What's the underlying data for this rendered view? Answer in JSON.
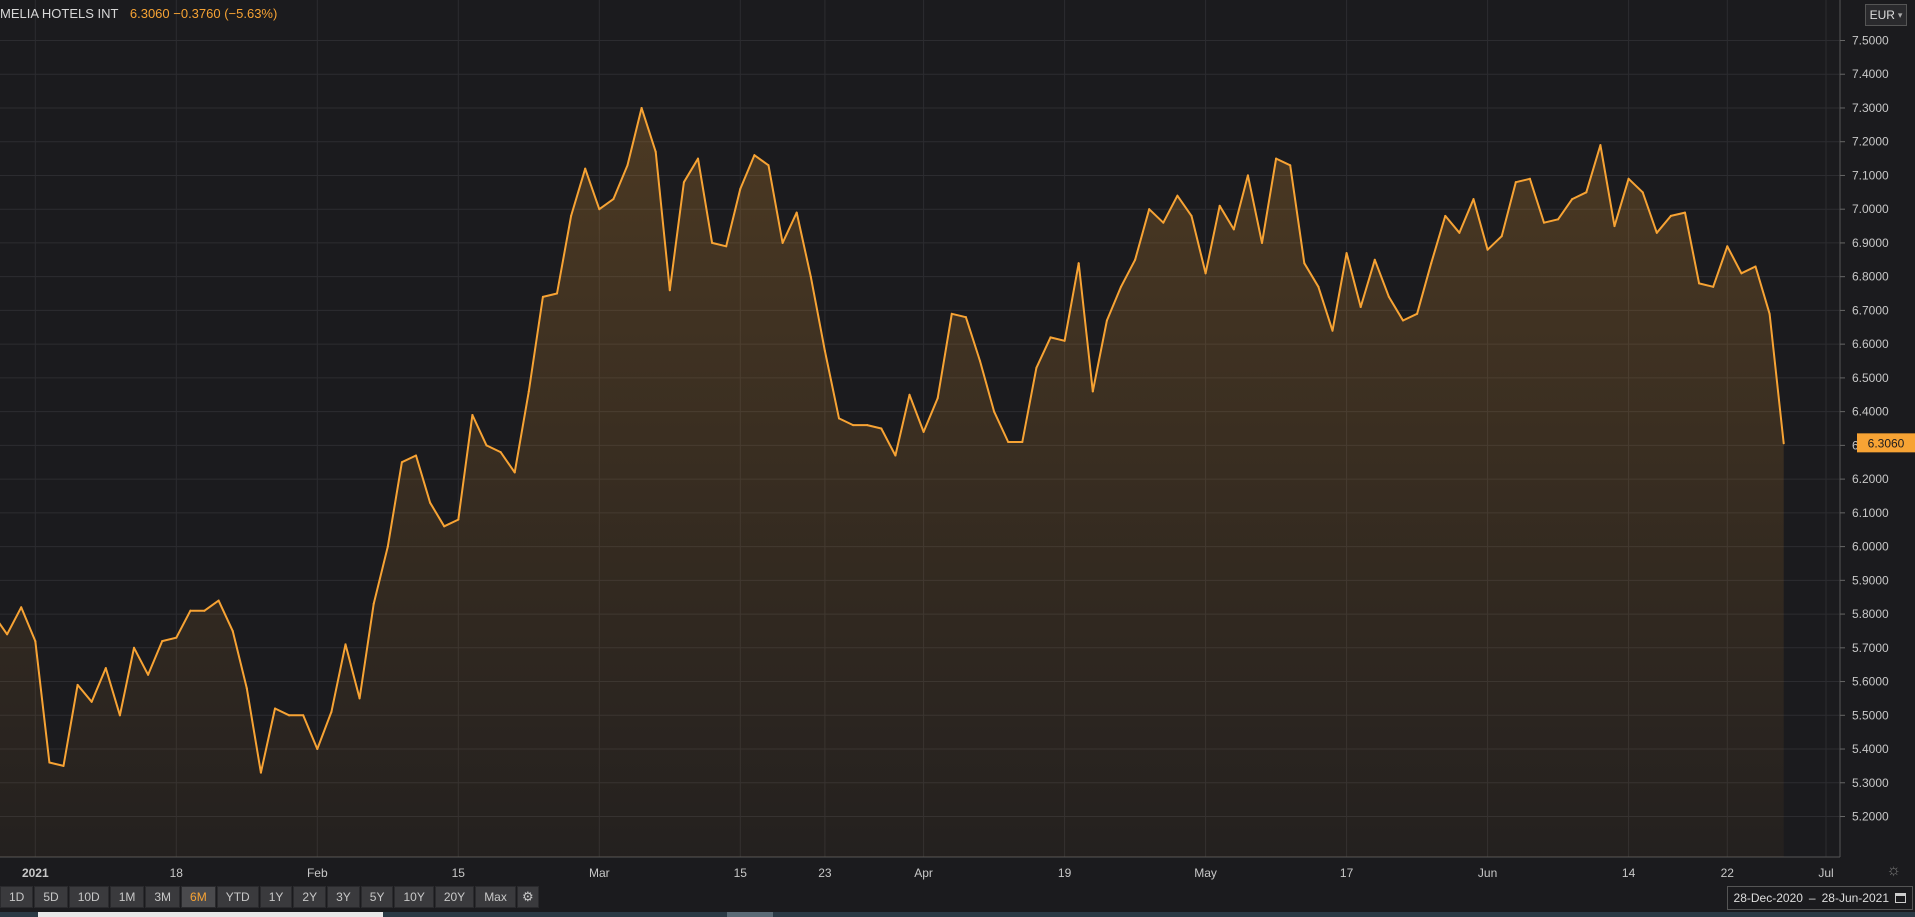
{
  "header": {
    "instrument": "MELIA HOTELS INT",
    "quote": "6.3060  −0.3760 (−5.63%)"
  },
  "currency": {
    "label": "EUR",
    "chevron": "chevron-down-icon"
  },
  "range_buttons": [
    "1D",
    "5D",
    "10D",
    "1M",
    "3M",
    "6M",
    "YTD",
    "1Y",
    "2Y",
    "3Y",
    "5Y",
    "10Y",
    "20Y",
    "Max"
  ],
  "active_range": "6M",
  "date_range": {
    "from": "28-Dec-2020",
    "separator": "–",
    "to": "28-Jun-2021"
  },
  "colors": {
    "line": "#f7a334",
    "background": "#1b1b1e",
    "grid": "#2c2c30",
    "accent": "#f7a334"
  },
  "chart_data": {
    "type": "area",
    "series": [
      {
        "name": "MELIA HOTELS INT",
        "values": [
          5.8,
          5.74,
          5.82,
          5.72,
          5.36,
          5.35,
          5.59,
          5.54,
          5.64,
          5.5,
          5.7,
          5.62,
          5.72,
          5.73,
          5.81,
          5.81,
          5.84,
          5.75,
          5.58,
          5.33,
          5.52,
          5.5,
          5.5,
          5.4,
          5.51,
          5.71,
          5.55,
          5.83,
          6.0,
          6.25,
          6.27,
          6.13,
          6.06,
          6.08,
          6.39,
          6.3,
          6.28,
          6.22,
          6.46,
          6.74,
          6.75,
          6.98,
          7.12,
          7.0,
          7.03,
          7.13,
          7.3,
          7.17,
          6.76,
          7.08,
          7.15,
          6.9,
          6.89,
          7.06,
          7.16,
          7.13,
          6.9,
          6.99,
          6.8,
          6.58,
          6.38,
          6.36,
          6.36,
          6.35,
          6.27,
          6.45,
          6.34,
          6.44,
          6.69,
          6.68,
          6.55,
          6.4,
          6.31,
          6.31,
          6.53,
          6.62,
          6.61,
          6.84,
          6.46,
          6.67,
          6.77,
          6.85,
          7.0,
          6.96,
          7.04,
          6.98,
          6.81,
          7.01,
          6.94,
          7.1,
          6.9,
          7.15,
          7.13,
          6.84,
          6.77,
          6.64,
          6.87,
          6.71,
          6.85,
          6.74,
          6.67,
          6.69,
          6.84,
          6.98,
          6.93,
          7.03,
          6.88,
          6.92,
          7.08,
          7.09,
          6.96,
          6.97,
          7.03,
          7.05,
          7.19,
          6.95,
          7.09,
          7.05,
          6.93,
          6.98,
          6.99,
          6.78,
          6.77,
          6.89,
          6.81,
          6.83,
          6.69,
          6.306
        ]
      }
    ],
    "x_tick_labels": [
      "2021",
      "18",
      "Feb",
      "15",
      "Mar",
      "15",
      "23",
      "Apr",
      "19",
      "May",
      "17",
      "Jun",
      "14",
      "22",
      "Jul"
    ],
    "x_tick_index": [
      3,
      13,
      23,
      33,
      43,
      53,
      59,
      66,
      76,
      86,
      96,
      106,
      116,
      123,
      130
    ],
    "y_tick_labels": [
      "5.2000",
      "5.3000",
      "5.4000",
      "5.5000",
      "5.6000",
      "5.7000",
      "5.8000",
      "5.9000",
      "6.0000",
      "6.1000",
      "6.2000",
      "6.3000",
      "6.4000",
      "6.5000",
      "6.6000",
      "6.7000",
      "6.8000",
      "6.9000",
      "7.0000",
      "7.1000",
      "7.2000",
      "7.3000",
      "7.4000",
      "7.5000"
    ],
    "y_ticks": [
      5.2,
      5.3,
      5.4,
      5.5,
      5.6,
      5.7,
      5.8,
      5.9,
      6.0,
      6.1,
      6.2,
      6.3,
      6.4,
      6.5,
      6.6,
      6.7,
      6.8,
      6.9,
      7.0,
      7.1,
      7.2,
      7.3,
      7.4,
      7.5
    ],
    "ylim": [
      5.08,
      7.62
    ],
    "last_value_label": "6.3060",
    "grid": true
  }
}
